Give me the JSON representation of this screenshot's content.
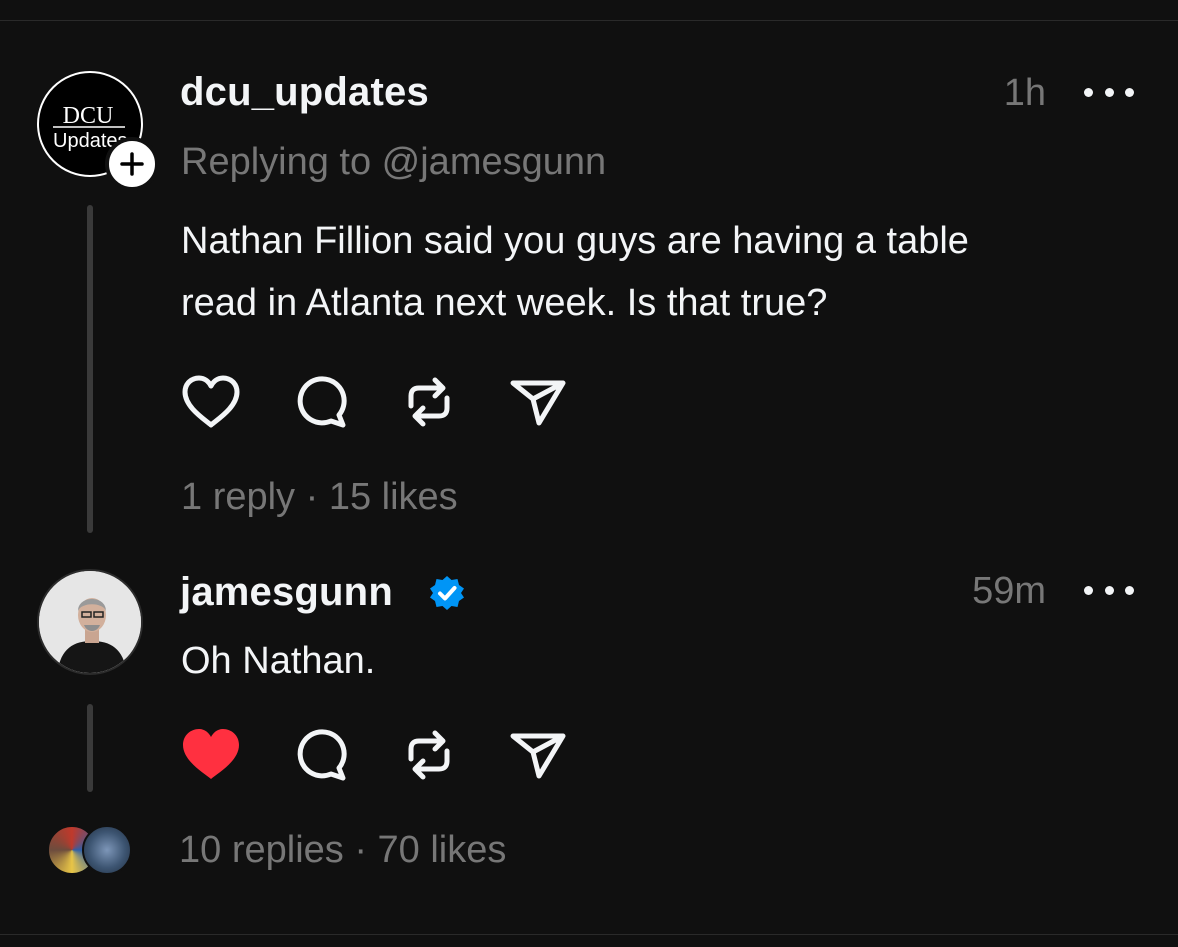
{
  "posts": [
    {
      "username": "dcu_updates",
      "avatar_text_top": "DCU",
      "avatar_text_bottom": "Updates",
      "reply_to": "Replying to @jamesgunn",
      "time": "1h",
      "text_line1": "Nathan Fillion said you guys are having a table",
      "text_line2": "read in Atlanta next week. Is that true?",
      "liked": false,
      "stats": "1 reply · 15 likes"
    },
    {
      "username": "jamesgunn",
      "verified": true,
      "time": "59m",
      "text": "Oh Nathan.",
      "liked": true,
      "stats": "10 replies · 70 likes"
    }
  ],
  "colors": {
    "background": "#101010",
    "primary_text": "#f3f5f7",
    "secondary_text": "#777777",
    "like_red": "#ff3040",
    "verified_blue": "#0095f6"
  },
  "icons": [
    "heart-icon",
    "comment-icon",
    "repost-icon",
    "share-icon",
    "more-icon",
    "follow-plus-icon",
    "verified-badge-icon"
  ]
}
